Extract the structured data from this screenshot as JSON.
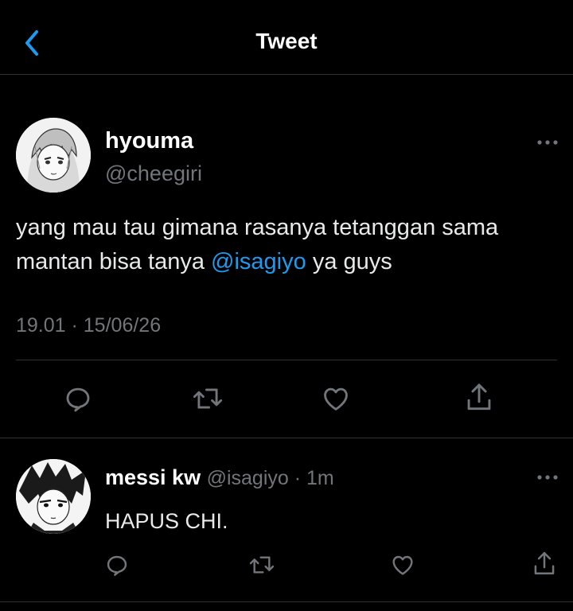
{
  "header": {
    "title": "Tweet"
  },
  "tweet": {
    "author_name": "hyouma",
    "author_handle": "@cheegiri",
    "text_part1": "yang mau tau gimana rasanya tetanggan sama mantan bisa tanya ",
    "mention": "@isagiyo",
    "text_part2": " ya guys",
    "time": "19.01",
    "separator": " · ",
    "date": "15/06/26"
  },
  "reply": {
    "author_name": "messi kw",
    "author_handle": "@isagiyo",
    "separator": " · ",
    "time_ago": "1m",
    "text": "HAPUS CHI."
  },
  "icons": [
    "back-chevron-icon",
    "more-dots-icon",
    "reply-icon",
    "retweet-icon",
    "like-icon",
    "share-icon"
  ],
  "colors": {
    "background": "#000000",
    "accent": "#1d9bf0",
    "muted": "#71767b",
    "divider": "#2f3336"
  }
}
